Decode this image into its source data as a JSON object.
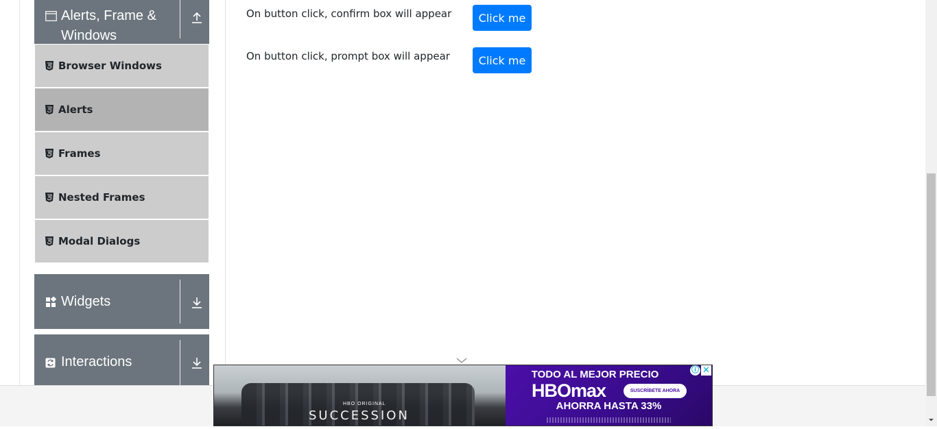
{
  "sidebar": {
    "groups": [
      {
        "title_line1": "Alerts, Frame &",
        "title_line2": "Windows",
        "icon": "window-icon",
        "toggle": "expanded"
      },
      {
        "title": "Widgets",
        "icon": "widgets-grid-icon",
        "toggle": "collapsed"
      },
      {
        "title": "Interactions",
        "icon": "interactions-icon",
        "toggle": "collapsed"
      }
    ],
    "items": [
      {
        "label": "Browser Windows",
        "active": false
      },
      {
        "label": "Alerts",
        "active": true
      },
      {
        "label": "Frames",
        "active": false
      },
      {
        "label": "Nested Frames",
        "active": false
      },
      {
        "label": "Modal Dialogs",
        "active": false
      }
    ],
    "item_icon": "html5-icon"
  },
  "main": {
    "rows": [
      {
        "text": "On button click, confirm box will appear",
        "button": "Click me"
      },
      {
        "text": "On button click, prompt box will appear",
        "button": "Click me"
      }
    ]
  },
  "ad": {
    "badge": "HBO ORIGINAL",
    "show": "SUCCESSION",
    "headline": "TODO AL MEJOR PRECIO",
    "brand": "HBOmax",
    "cta": "SUSCRÍBETE AHORA",
    "savings": "AHORRA HASTA 33%",
    "info_icon": "ⓘ",
    "close_icon": "✕"
  },
  "colors": {
    "group_header": "#6c757d",
    "menu_item": "#cccccc",
    "menu_item_active": "#b3b3b3",
    "primary_button": "#007bff",
    "ad_purple": "#4b0fa8"
  }
}
